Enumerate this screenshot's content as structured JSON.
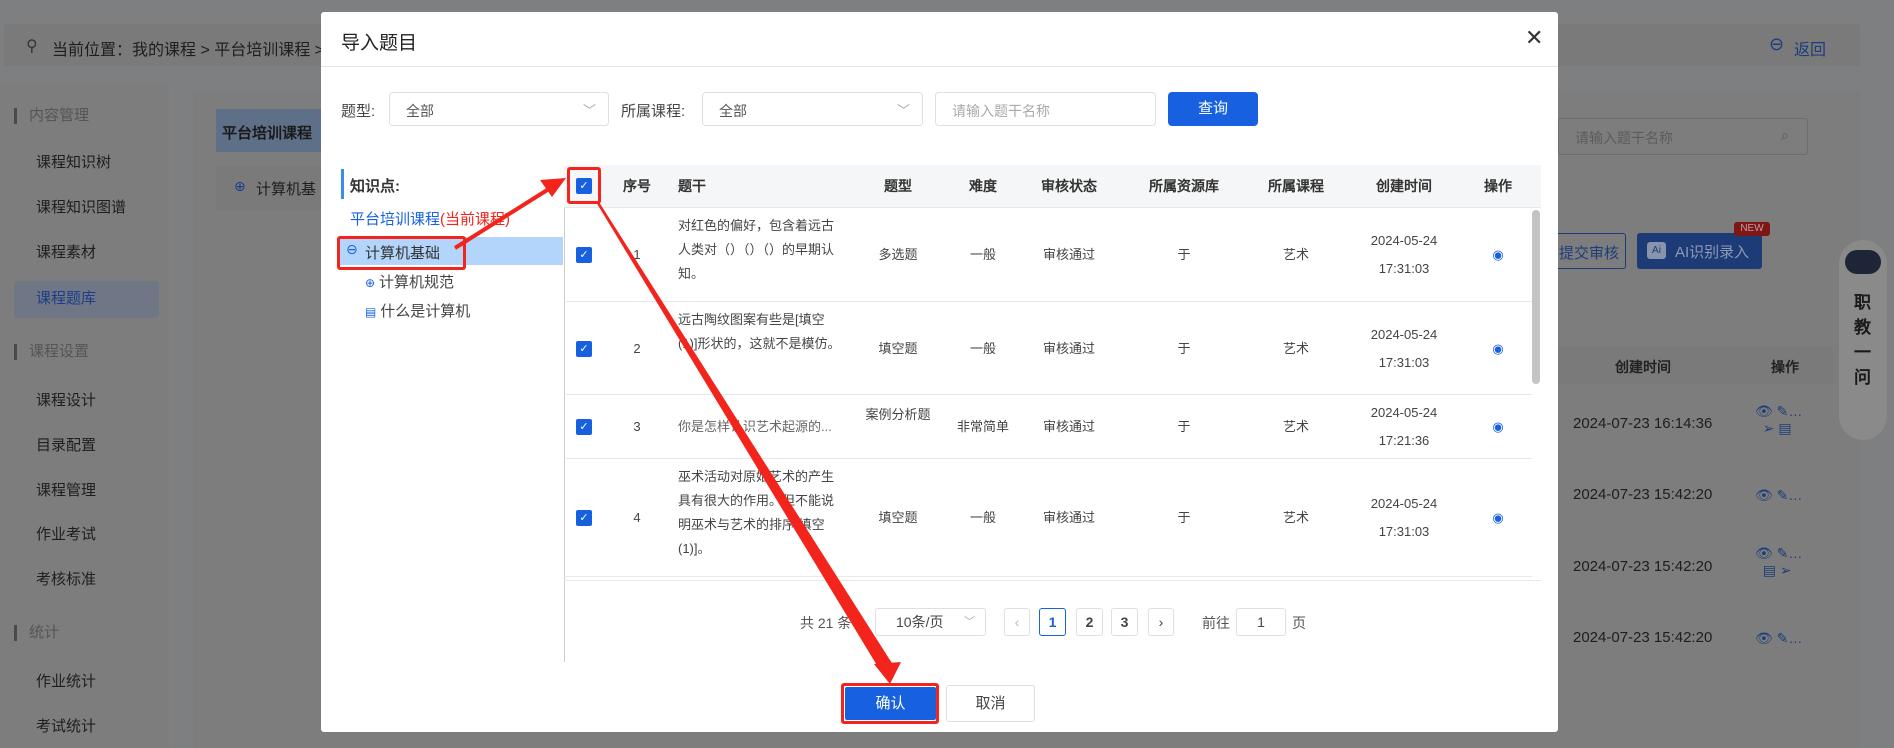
{
  "breadcrumb": {
    "text": "当前位置：我的课程 > 平台培训课程 > ",
    "back_label": "返回"
  },
  "sidebar": {
    "groups": [
      {
        "title": "内容管理",
        "items": [
          "课程知识树",
          "课程知识图谱",
          "课程素材",
          "课程题库"
        ]
      },
      {
        "title": "课程设置",
        "items": [
          "课程设计",
          "目录配置",
          "课程管理",
          "作业考试",
          "考核标准"
        ]
      },
      {
        "title": "统计",
        "items": [
          "作业统计",
          "考试统计"
        ]
      }
    ],
    "active_item": "课程题库"
  },
  "background": {
    "course_header": "平台培训课程",
    "tree_item": "计算机基",
    "search_placeholder": "请输入题干名称",
    "submit_review_label": "提交审核",
    "ai_button_label": "AI识别录入",
    "ai_badge": "NEW",
    "table_headers": [
      "创建时间",
      "操作"
    ],
    "rows": [
      "2024-07-23 16:14:36",
      "2024-07-23 15:42:20",
      "2024-07-23 15:42:20",
      "2024-07-23 15:42:20"
    ],
    "assistant_label": "职教一问"
  },
  "modal": {
    "title": "导入题目",
    "filters": {
      "type_label": "题型:",
      "type_value": "全部",
      "course_label": "所属课程:",
      "course_value": "全部",
      "keyword_placeholder": "请输入题干名称",
      "query_label": "查询"
    },
    "tree": {
      "heading": "知识点:",
      "root": "平台培训课程",
      "root_suffix": "(当前课程)",
      "selected": "计算机基础",
      "children": [
        "计算机规范",
        "什么是计算机"
      ]
    },
    "table": {
      "headers": [
        "序号",
        "题干",
        "题型",
        "难度",
        "审核状态",
        "所属资源库",
        "所属课程",
        "创建时间",
        "操作"
      ],
      "rows": [
        {
          "no": "1",
          "stem": "对红色的偏好，包含着远古人类对（）（）（）的早期认知。",
          "type": "多选题",
          "difficulty": "一般",
          "status": "审核通过",
          "library": "于",
          "course": "艺术",
          "date": "2024-05-24",
          "time": "17:31:03",
          "checked": true
        },
        {
          "no": "2",
          "stem": "远古陶纹图案有些是[填空(1)]形状的，这就不是模仿。",
          "type": "填空题",
          "difficulty": "一般",
          "status": "审核通过",
          "library": "于",
          "course": "艺术",
          "date": "2024-05-24",
          "time": "17:31:03",
          "checked": true
        },
        {
          "no": "3",
          "stem": "你是怎样认识艺术起源的...",
          "type": "案例分析题",
          "difficulty": "非常简单",
          "status": "审核通过",
          "library": "于",
          "course": "艺术",
          "date": "2024-05-24",
          "time": "17:21:36",
          "checked": true
        },
        {
          "no": "4",
          "stem": "巫术活动对原始艺术的产生具有很大的作用。但不能说明巫术与艺术的排序[填空(1)]。",
          "type": "填空题",
          "difficulty": "一般",
          "status": "审核通过",
          "library": "于",
          "course": "艺术",
          "date": "2024-05-24",
          "time": "17:31:03",
          "checked": true
        }
      ]
    },
    "pagination": {
      "total": "共 21 条",
      "page_size": "10条/页",
      "pages": [
        "1",
        "2",
        "3"
      ],
      "current": "1",
      "goto_label": "前往",
      "goto_value": "1",
      "page_suffix": "页"
    },
    "confirm_label": "确认",
    "cancel_label": "取消"
  },
  "colors": {
    "primary": "#1761e0",
    "annotation": "#f2241c",
    "current_course": "#f2241c"
  }
}
